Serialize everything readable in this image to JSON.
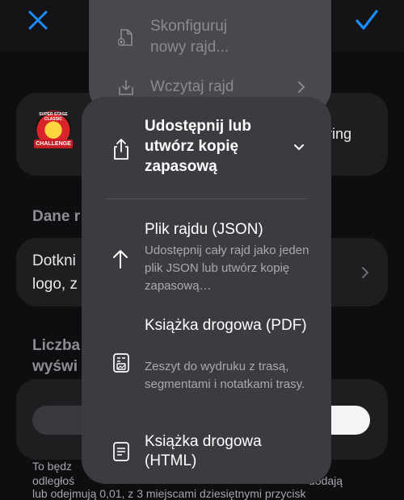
{
  "topbar": {
    "close_icon": "close-icon",
    "confirm_icon": "checkmark-icon",
    "accent": "#1a8cff"
  },
  "background": {
    "card1": {
      "logo_top": "SUPER STAGE CLASSIC",
      "logo_banner": "CHALLENGE",
      "tail_text": "ring"
    },
    "dane_heading": "Dane r",
    "card2": {
      "line1": "Dotkni",
      "line2": "logo, z"
    },
    "liczba_heading": {
      "line1": "Liczba",
      "line2": "wyświ"
    },
    "footer": {
      "line1": "To będz",
      "line2": "odległoś",
      "line2b": "dodają",
      "line3": "lub odejmują 0,01, z 3 miejscami dziesiętnymi przycisk"
    }
  },
  "back_menu": {
    "items": [
      {
        "icon": "new-document-icon",
        "label_line1": "Skonfiguruj",
        "label_line2": "nowy rajd..."
      },
      {
        "icon": "import-tray-icon",
        "label": "Wczytaj rajd"
      }
    ]
  },
  "menu": {
    "header": {
      "icon": "share-icon",
      "label": "Udostępnij lub utwórz kopię zapasową"
    },
    "items": [
      {
        "icon": "arrow-up-icon",
        "title": "Plik rajdu (JSON)",
        "subtitle": "Udostępnij cały rajd jako jeden plik JSON lub utwórz kopię zapasową…"
      },
      {
        "icon": "pdf-document-icon",
        "title": "Książka drogowa (PDF)",
        "subtitle": "Zeszyt do wydruku z trasą, segmentami i notatkami trasy."
      },
      {
        "icon": "html-document-icon",
        "title": "Książka drogowa (HTML)",
        "subtitle": ""
      }
    ]
  }
}
